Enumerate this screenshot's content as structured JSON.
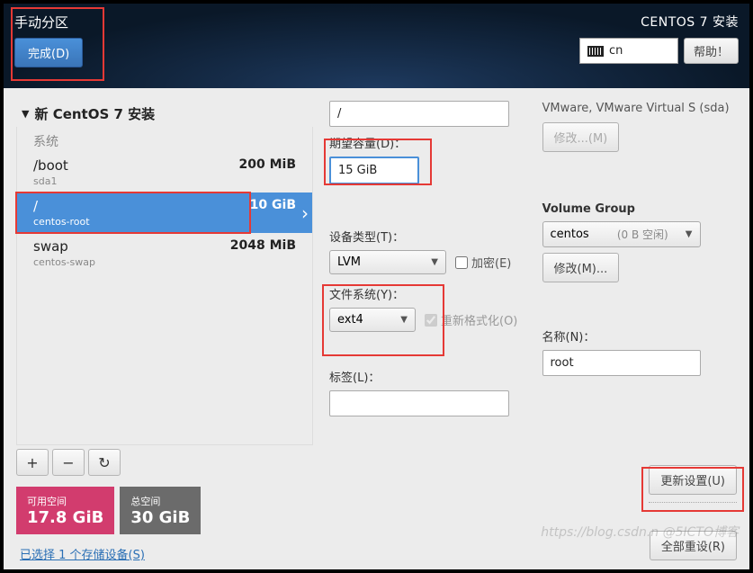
{
  "header": {
    "title": "手动分区",
    "done": "完成(D)",
    "product": "CENTOS 7 安装",
    "lang": "cn",
    "help": "帮助！"
  },
  "left": {
    "install_label": "新 CentOS 7 安装",
    "system": "系统",
    "partitions": [
      {
        "mount": "/boot",
        "size": "200 MiB",
        "device": "sda1"
      },
      {
        "mount": "/",
        "size": "10 GiB",
        "device": "centos-root"
      },
      {
        "mount": "swap",
        "size": "2048 MiB",
        "device": "centos-swap"
      }
    ],
    "avail_label": "可用空间",
    "avail_value": "17.8 GiB",
    "total_label": "总空间",
    "total_value": "30 GiB",
    "storage_link": "已选择 1 个存储设备(S)"
  },
  "right": {
    "mount_value": "/",
    "capacity_label": "期望容量(D)：",
    "capacity_value": "15 GiB",
    "device_type_label": "设备类型(T)：",
    "device_type_value": "LVM",
    "encrypt": "加密(E)",
    "fs_label": "文件系统(Y)：",
    "fs_value": "ext4",
    "reformat": "重新格式化(O)",
    "tag_label": "标签(L)：",
    "tag_value": "",
    "disk_name": "VMware, VMware Virtual S (sda)",
    "modify_disk": "修改...(M)",
    "vg_label": "Volume Group",
    "vg_value": "centos",
    "vg_free": "(0 B 空闲)",
    "vg_modify": "修改(M)...",
    "name_label": "名称(N)：",
    "name_value": "root",
    "update": "更新设置(U)",
    "reset_all": "全部重设(R)"
  },
  "watermark": "https://blog.csdn.n  @5ICTO博客"
}
